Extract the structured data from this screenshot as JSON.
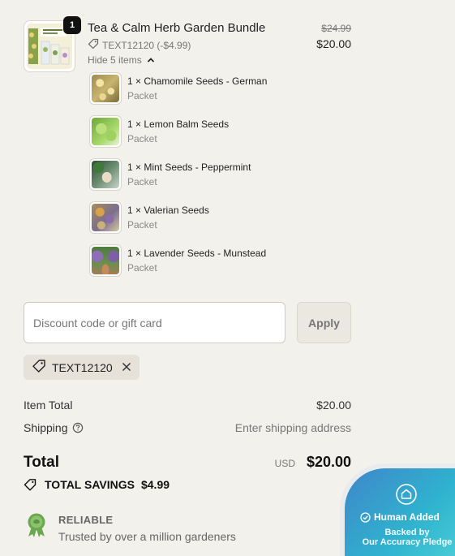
{
  "product": {
    "title": "Tea & Calm Herb Garden Bundle",
    "quantity": "1",
    "discount_label": "TEXT12120 (-$4.99)",
    "toggle_label": "Hide 5 items",
    "original_price": "$24.99",
    "price": "$20.00",
    "items": [
      {
        "name": "1 × Chamomile Seeds - German",
        "variant": "Packet"
      },
      {
        "name": "1 × Lemon Balm Seeds",
        "variant": "Packet"
      },
      {
        "name": "1 × Mint Seeds - Peppermint",
        "variant": "Packet"
      },
      {
        "name": "1 × Valerian Seeds",
        "variant": "Packet"
      },
      {
        "name": "1 × Lavender Seeds - Munstead",
        "variant": "Packet"
      }
    ]
  },
  "discount": {
    "placeholder": "Discount code or gift card",
    "apply_label": "Apply",
    "applied_code": "TEXT12120"
  },
  "summary": {
    "item_total_label": "Item Total",
    "item_total_value": "$20.00",
    "shipping_label": "Shipping",
    "shipping_value": "Enter shipping address",
    "total_label": "Total",
    "currency": "USD",
    "total_value": "$20.00",
    "savings_label": "TOTAL SAVINGS",
    "savings_value": "$4.99"
  },
  "trust": {
    "title": "RELIABLE",
    "subtitle": "Trusted by over a million gardeners"
  },
  "human_added": {
    "title": "Human Added",
    "line1": "Backed by",
    "line2": "Our Accuracy Pledge"
  },
  "colors": {
    "background": "#f3f1ec",
    "badge": "#111111",
    "widget_start": "#3f86c9",
    "widget_end": "#4fd4d8",
    "reliable_icon": "#6aa84f"
  },
  "icons": [
    "tag-icon",
    "chevron-up-icon",
    "close-icon",
    "help-circle-icon",
    "award-badge-icon",
    "shield-home-icon",
    "check-circle-icon"
  ]
}
